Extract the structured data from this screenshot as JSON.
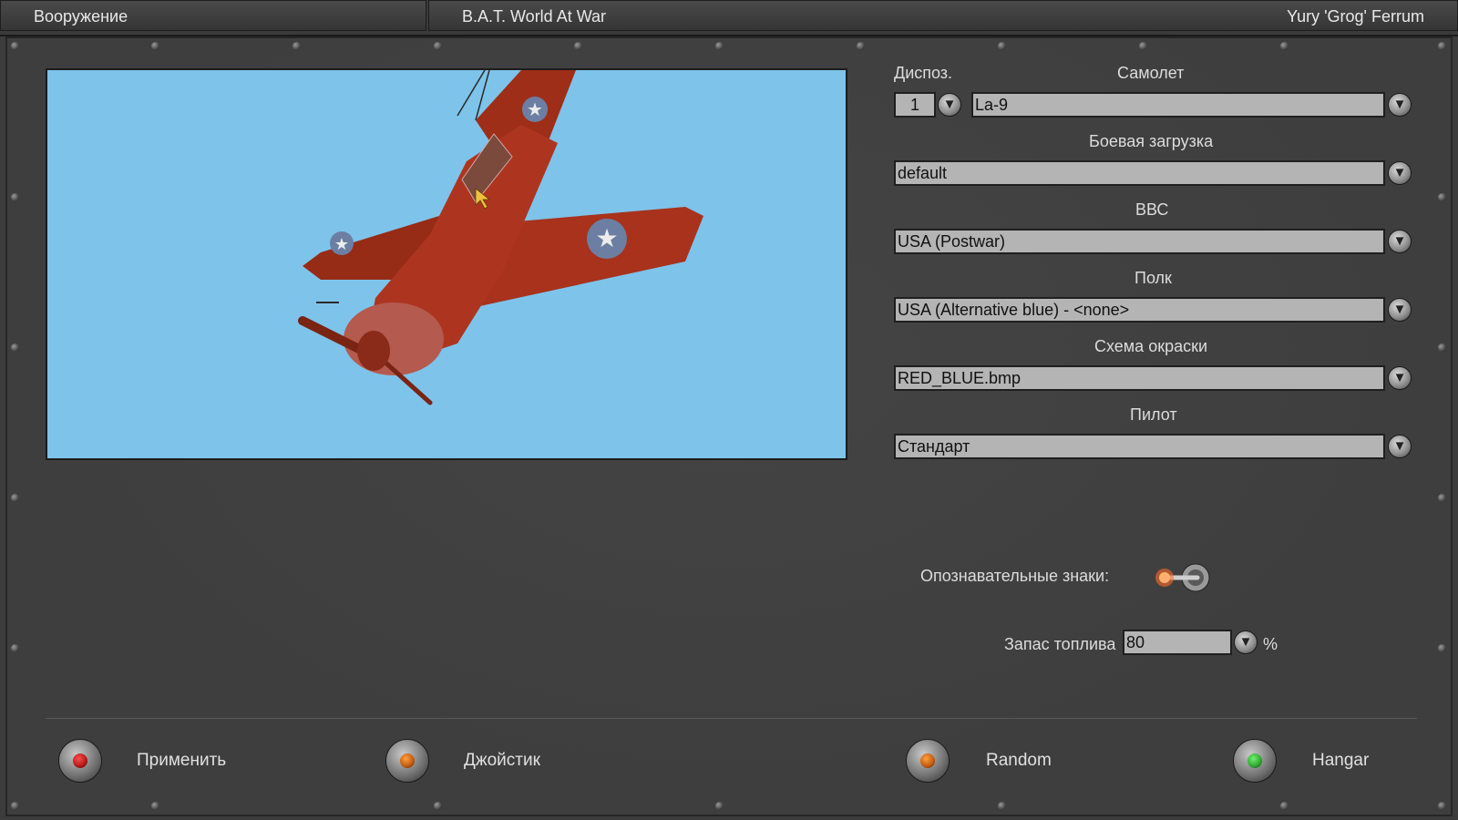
{
  "titlebar": {
    "section": "Вооружение",
    "game": "B.A.T. World At War",
    "user": "Yury 'Grog' Ferrum"
  },
  "form": {
    "slot_label": "Диспоз.",
    "slot_value": "1",
    "plane_label": "Самолет",
    "plane_value": "La-9",
    "loadout_label": "Боевая загрузка",
    "loadout_value": "default",
    "airforce_label": "ВВС",
    "airforce_value": "USA (Postwar)",
    "regiment_label": "Полк",
    "regiment_value": "USA (Alternative blue) - <none>",
    "skin_label": "Схема окраски",
    "skin_value": "RED_BLUE.bmp",
    "pilot_label": "Пилот",
    "pilot_value": "Стандарт",
    "markings_label": "Опознавательные знаки:",
    "fuel_label": "Запас топлива",
    "fuel_value": "80",
    "fuel_unit": "%"
  },
  "buttons": {
    "apply": "Применить",
    "joystick": "Джойстик",
    "random": "Random",
    "hangar": "Hangar"
  },
  "colors": {
    "sky": "#7ec3ea",
    "plane": "#a8321c",
    "lamp_red": "#b01818",
    "lamp_orange": "#c05a10",
    "lamp_green": "#2fa52f"
  },
  "icons": {
    "dropdown": "chevron-down-icon"
  }
}
